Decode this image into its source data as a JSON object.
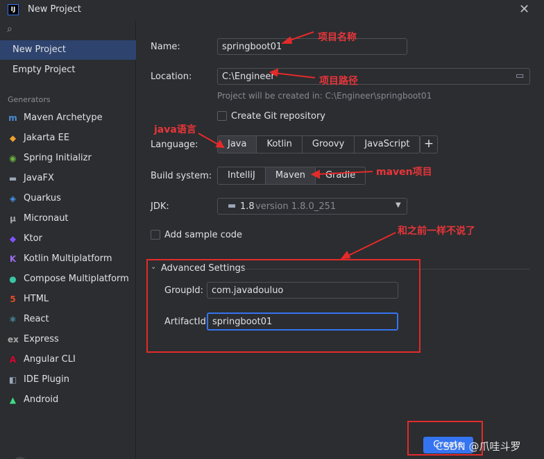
{
  "window": {
    "title": "New Project",
    "app_icon_text": "IJ"
  },
  "sidebar": {
    "items": [
      {
        "label": "New Project"
      },
      {
        "label": "Empty Project"
      }
    ],
    "generators_header": "Generators",
    "generators": [
      {
        "label": "Maven Archetype",
        "icon": "m-icon",
        "glyph": "m",
        "color": "#4a8fd8"
      },
      {
        "label": "Jakarta EE",
        "icon": "jakarta-icon",
        "glyph": "◆",
        "color": "#f0a030"
      },
      {
        "label": "Spring Initializr",
        "icon": "spring-icon",
        "glyph": "◉",
        "color": "#6db33f"
      },
      {
        "label": "JavaFX",
        "icon": "folder-icon",
        "glyph": "▬",
        "color": "#9aa7b8"
      },
      {
        "label": "Quarkus",
        "icon": "quarkus-icon",
        "glyph": "◈",
        "color": "#4695eb"
      },
      {
        "label": "Micronaut",
        "icon": "micronaut-icon",
        "glyph": "μ",
        "color": "#aaaaaa"
      },
      {
        "label": "Ktor",
        "icon": "ktor-icon",
        "glyph": "◆",
        "color": "#7f52ff"
      },
      {
        "label": "Kotlin Multiplatform",
        "icon": "kotlin-icon",
        "glyph": "K",
        "color": "#9f6bf0"
      },
      {
        "label": "Compose Multiplatform",
        "icon": "compose-icon",
        "glyph": "●",
        "color": "#38c6a5"
      },
      {
        "label": "HTML",
        "icon": "html5-icon",
        "glyph": "5",
        "color": "#e44d26"
      },
      {
        "label": "React",
        "icon": "react-icon",
        "glyph": "⚛",
        "color": "#61dafb"
      },
      {
        "label": "Express",
        "icon": "express-icon",
        "glyph": "ex",
        "color": "#aaaaaa"
      },
      {
        "label": "Angular CLI",
        "icon": "angular-icon",
        "glyph": "A",
        "color": "#dd0031"
      },
      {
        "label": "IDE Plugin",
        "icon": "plugin-icon",
        "glyph": "◧",
        "color": "#9aa7b8"
      },
      {
        "label": "Android",
        "icon": "android-icon",
        "glyph": "▲",
        "color": "#3ddc84"
      }
    ]
  },
  "form": {
    "name_label": "Name:",
    "name_value": "springboot01",
    "location_label": "Location:",
    "location_value": "C:\\Engineer",
    "created_hint": "Project will be created in: C:\\Engineer\\springboot01",
    "git_label": "Create Git repository",
    "language_label": "Language:",
    "languages": [
      "Java",
      "Kotlin",
      "Groovy",
      "JavaScript"
    ],
    "language_selected": "Java",
    "build_label": "Build system:",
    "build_systems": [
      "IntelliJ",
      "Maven",
      "Gradle"
    ],
    "build_selected": "Maven",
    "jdk_label": "JDK:",
    "jdk_version": "1.8",
    "jdk_detail": "version 1.8.0_251",
    "sample_label": "Add sample code",
    "advanced_label": "Advanced Settings",
    "groupid_label": "GroupId:",
    "groupid_value": "com.javadouluo",
    "artifactid_label": "ArtifactId:",
    "artifactid_value": "springboot01"
  },
  "annotations": {
    "name_note": "项目名称",
    "location_note": "项目路径",
    "java_note": "java语言",
    "maven_note": "maven项目",
    "advanced_note": "和之前一样不说了"
  },
  "footer": {
    "help": "?",
    "create_label": "Create",
    "watermark": "CSDN @爪哇斗罗"
  },
  "colors": {
    "accent": "#3574f0",
    "selected": "#2e436e",
    "annotation_red": "#e52a2a"
  }
}
